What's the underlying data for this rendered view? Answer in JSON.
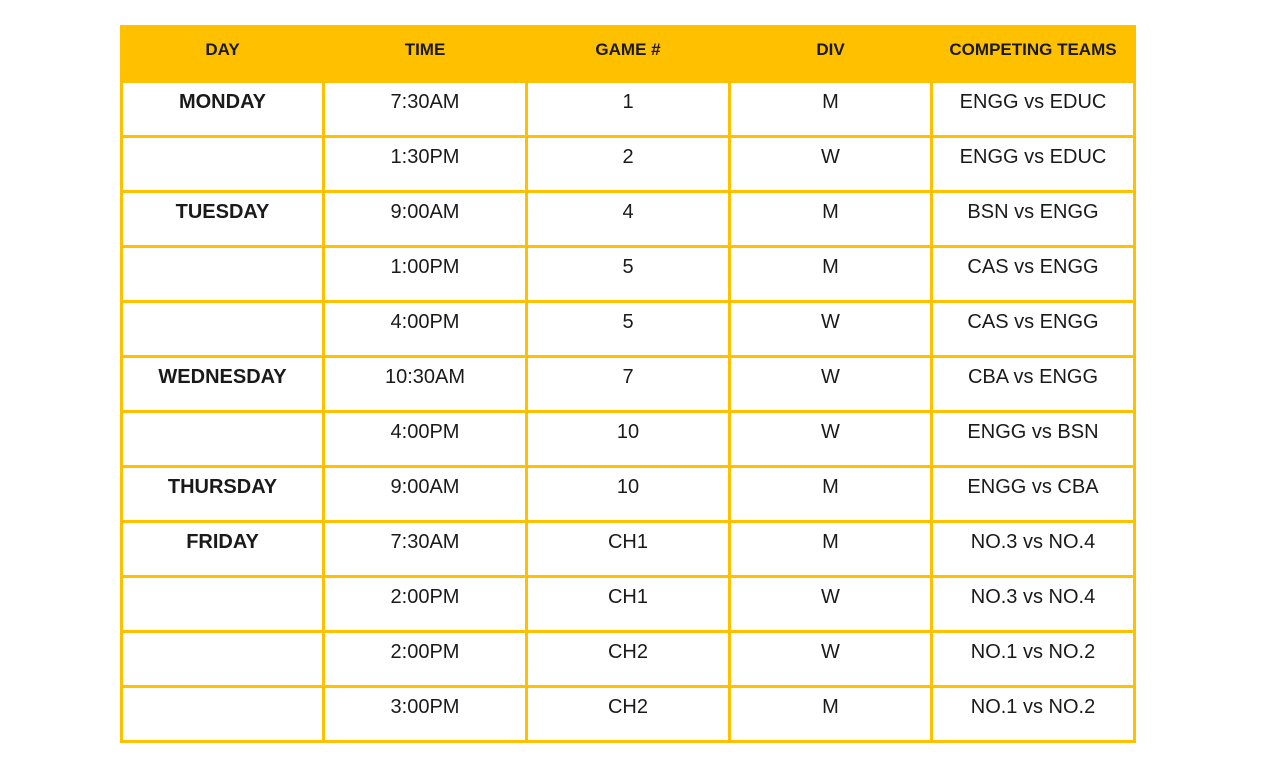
{
  "colors": {
    "accent": "#FFC000",
    "text": "#1a1a1a",
    "background": "#ffffff"
  },
  "table": {
    "headers": {
      "day": "DAY",
      "time": "TIME",
      "game": "GAME #",
      "div": "DIV",
      "teams": "COMPETING TEAMS"
    },
    "rows": [
      {
        "day": "MONDAY",
        "time": "7:30AM",
        "game": "1",
        "div": "M",
        "teams": "ENGG vs EDUC"
      },
      {
        "day": "",
        "time": "1:30PM",
        "game": "2",
        "div": "W",
        "teams": "ENGG vs EDUC"
      },
      {
        "day": "TUESDAY",
        "time": "9:00AM",
        "game": "4",
        "div": "M",
        "teams": "BSN vs ENGG"
      },
      {
        "day": "",
        "time": "1:00PM",
        "game": "5",
        "div": "M",
        "teams": "CAS vs ENGG"
      },
      {
        "day": "",
        "time": "4:00PM",
        "game": "5",
        "div": "W",
        "teams": "CAS vs ENGG"
      },
      {
        "day": "WEDNESDAY",
        "time": "10:30AM",
        "game": "7",
        "div": "W",
        "teams": "CBA vs ENGG"
      },
      {
        "day": "",
        "time": "4:00PM",
        "game": "10",
        "div": "W",
        "teams": "ENGG vs BSN"
      },
      {
        "day": "THURSDAY",
        "time": "9:00AM",
        "game": "10",
        "div": "M",
        "teams": "ENGG vs CBA"
      },
      {
        "day": "FRIDAY",
        "time": "7:30AM",
        "game": "CH1",
        "div": "M",
        "teams": "NO.3 vs NO.4"
      },
      {
        "day": "",
        "time": "2:00PM",
        "game": "CH1",
        "div": "W",
        "teams": "NO.3 vs NO.4"
      },
      {
        "day": "",
        "time": "2:00PM",
        "game": "CH2",
        "div": "W",
        "teams": "NO.1 vs NO.2"
      },
      {
        "day": "",
        "time": "3:00PM",
        "game": "CH2",
        "div": "M",
        "teams": "NO.1 vs NO.2"
      }
    ]
  }
}
